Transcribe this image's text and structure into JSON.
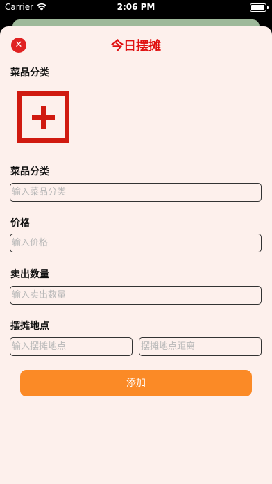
{
  "status_bar": {
    "carrier": "Carrier",
    "time": "2:06 PM"
  },
  "header": {
    "title": "今日摆摊",
    "close_icon": "close-icon"
  },
  "form": {
    "category_image_label": "菜品分类",
    "category_label": "菜品分类",
    "category_placeholder": "输入菜品分类",
    "price_label": "价格",
    "price_placeholder": "输入价格",
    "quantity_label": "卖出数量",
    "quantity_placeholder": "输入卖出数量",
    "location_label": "摆摊地点",
    "location_placeholder": "输入摆摊地点",
    "distance_placeholder": "摆摊地点距离",
    "submit_label": "添加"
  },
  "colors": {
    "accent": "#fb8a26",
    "title": "#e01010",
    "sheet": "#fdf0ec"
  }
}
